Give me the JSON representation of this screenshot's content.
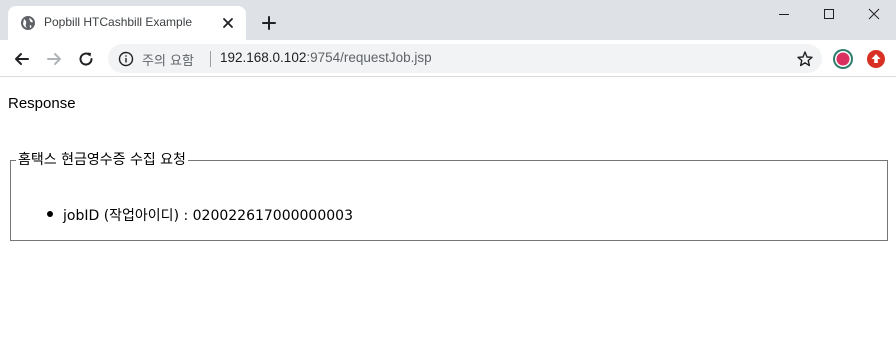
{
  "browser": {
    "tab": {
      "title": "Popbill HTCashbill Example"
    },
    "address_bar": {
      "security_label": "주의 요함",
      "url_host": "192.168.0.102",
      "url_path": ":9754/requestJob.jsp"
    },
    "colors": {
      "tabstrip_bg": "#dee1e6",
      "omnibox_bg": "#f1f3f4"
    }
  },
  "page": {
    "heading": "Response",
    "fieldset": {
      "legend": "홈택스 현금영수증 수집 요청",
      "items": [
        {
          "text": "jobID (작업아이디) : 020022617000000003"
        }
      ]
    }
  }
}
